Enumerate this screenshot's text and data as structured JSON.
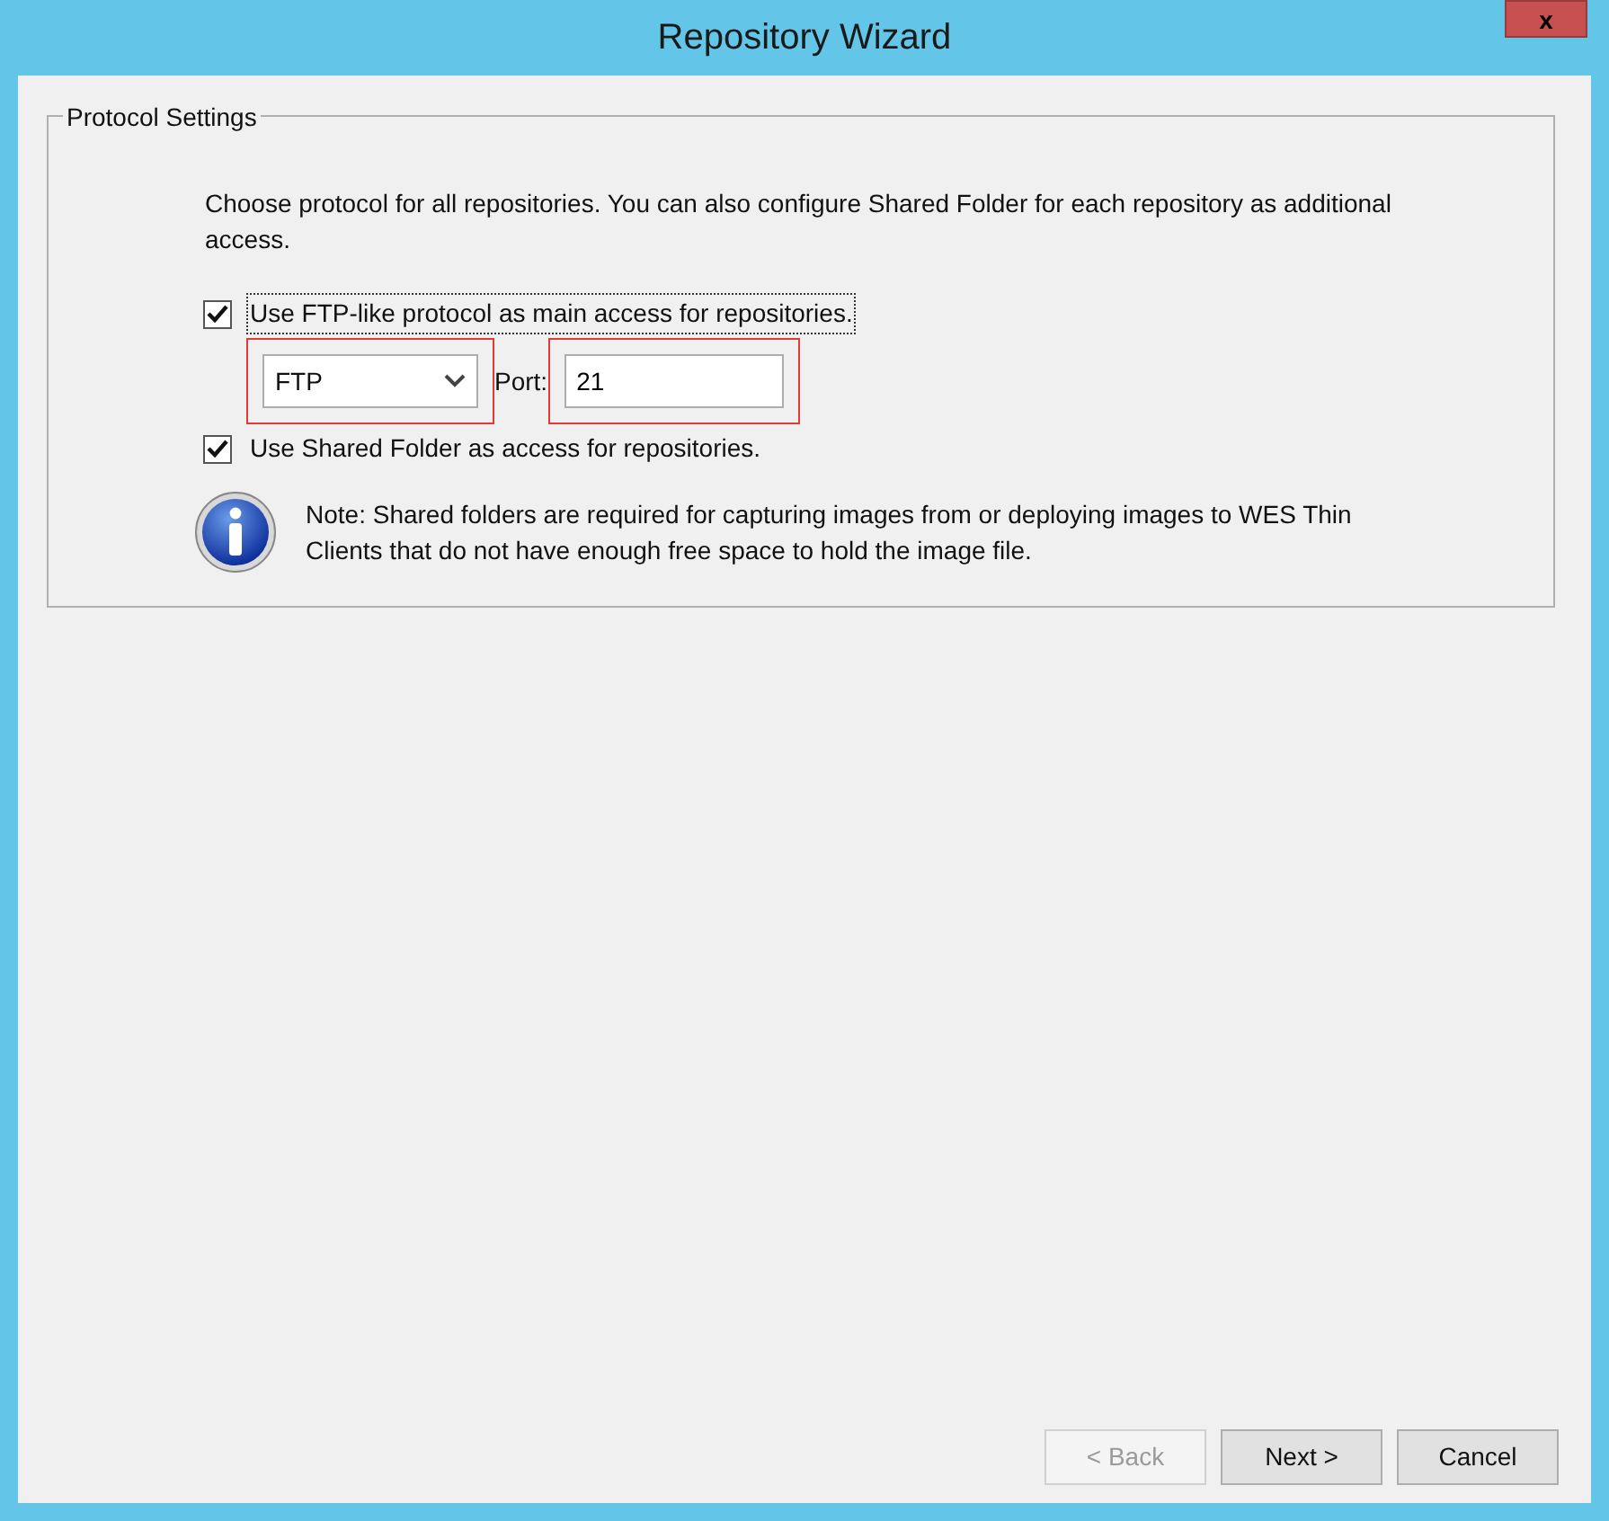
{
  "window": {
    "title": "Repository Wizard",
    "close": "x"
  },
  "group": {
    "title": "Protocol Settings",
    "intro": "Choose protocol for all repositories. You can also configure Shared Folder for each repository as additional access.",
    "ftp_option": {
      "label": "Use FTP-like protocol as main access for repositories.",
      "checked": true,
      "focused": true
    },
    "protocol": {
      "value": "FTP",
      "highlighted": true
    },
    "port": {
      "label": "Port:",
      "value": "21",
      "highlighted": true
    },
    "shared_option": {
      "label": "Use Shared Folder as access for repositories.",
      "checked": true,
      "focused": false
    },
    "note": "Note: Shared folders are required for capturing images from or deploying images to WES Thin Clients that do not have enough free space to hold the image file."
  },
  "buttons": [
    {
      "label": "< Back",
      "disabled": true
    },
    {
      "label": "Next >",
      "disabled": false
    },
    {
      "label": "Cancel",
      "disabled": false
    }
  ]
}
